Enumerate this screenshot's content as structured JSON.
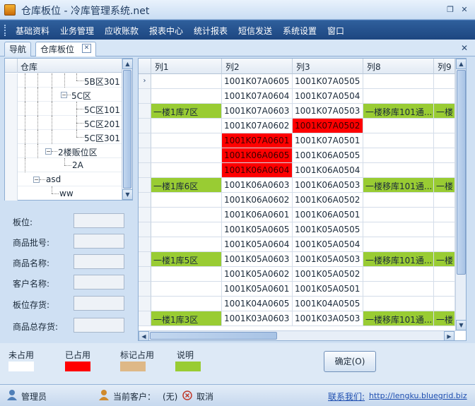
{
  "window": {
    "title": "仓库板位 - 冷库管理系统.net",
    "icon": "warehouse-app-icon",
    "restore_icon": "restore-icon",
    "close_icon": "close-icon"
  },
  "menu": [
    {
      "label": "基础资料"
    },
    {
      "label": "业务管理"
    },
    {
      "label": "应收账款"
    },
    {
      "label": "报表中心"
    },
    {
      "label": "统计报表"
    },
    {
      "label": "短信发送"
    },
    {
      "label": "系统设置"
    },
    {
      "label": "窗口"
    }
  ],
  "tabs": [
    {
      "label": "导航"
    },
    {
      "label": "仓库板位"
    }
  ],
  "tree": {
    "header": "仓库",
    "items": [
      {
        "label": "5B区301"
      },
      {
        "label": "5C区"
      },
      {
        "label": "5C区101"
      },
      {
        "label": "5C区201"
      },
      {
        "label": "5C区301"
      },
      {
        "label": "2楼贩位区"
      },
      {
        "label": "2A"
      },
      {
        "label": "asd"
      },
      {
        "label": "ww"
      }
    ]
  },
  "form": [
    {
      "label": "板位:"
    },
    {
      "label": "商品批号:"
    },
    {
      "label": "商品名称:"
    },
    {
      "label": "客户名称:"
    },
    {
      "label": "板位存货:"
    },
    {
      "label": "商品总存货:"
    }
  ],
  "grid": {
    "columns": [
      {
        "label": "列1"
      },
      {
        "label": "列2"
      },
      {
        "label": "列3"
      },
      {
        "label": "列8"
      },
      {
        "label": "列9"
      }
    ],
    "rows": [
      {
        "c1": "",
        "c2": "1001K07A0605",
        "c3": "1001K07A0505",
        "c8": "",
        "c9": "",
        "s2": "empty",
        "s3": "empty"
      },
      {
        "c1": "",
        "c2": "1001K07A0604",
        "c3": "1001K07A0504",
        "c8": "",
        "c9": "",
        "s2": "empty",
        "s3": "empty"
      },
      {
        "c1": "一楼1库7区",
        "c2": "1001K07A0603",
        "c3": "1001K07A0503",
        "c8": "一楼移库101通...",
        "c9": "一楼",
        "s2": "empty",
        "s3": "empty"
      },
      {
        "c1": "",
        "c2": "1001K07A0602",
        "c3": "1001K07A0502",
        "c8": "",
        "c9": "",
        "s2": "empty",
        "s3": "occupied"
      },
      {
        "c1": "",
        "c2": "1001K07A0601",
        "c3": "1001K07A0501",
        "c8": "",
        "c9": "",
        "s2": "occupied",
        "s3": "empty"
      },
      {
        "c1": "",
        "c2": "1001K06A0605",
        "c3": "1001K06A0505",
        "c8": "",
        "c9": "",
        "s2": "occupied",
        "s3": "empty"
      },
      {
        "c1": "",
        "c2": "1001K06A0604",
        "c3": "1001K06A0504",
        "c8": "",
        "c9": "",
        "s2": "occupied",
        "s3": "empty"
      },
      {
        "c1": "一楼1库6区",
        "c2": "1001K06A0603",
        "c3": "1001K06A0503",
        "c8": "一楼移库101通...",
        "c9": "一楼",
        "s2": "empty",
        "s3": "empty"
      },
      {
        "c1": "",
        "c2": "1001K06A0602",
        "c3": "1001K06A0502",
        "c8": "",
        "c9": "",
        "s2": "empty",
        "s3": "empty"
      },
      {
        "c1": "",
        "c2": "1001K06A0601",
        "c3": "1001K06A0501",
        "c8": "",
        "c9": "",
        "s2": "empty",
        "s3": "empty"
      },
      {
        "c1": "",
        "c2": "1001K05A0605",
        "c3": "1001K05A0505",
        "c8": "",
        "c9": "",
        "s2": "empty",
        "s3": "empty"
      },
      {
        "c1": "",
        "c2": "1001K05A0604",
        "c3": "1001K05A0504",
        "c8": "",
        "c9": "",
        "s2": "empty",
        "s3": "empty"
      },
      {
        "c1": "一楼1库5区",
        "c2": "1001K05A0603",
        "c3": "1001K05A0503",
        "c8": "一楼移库101通...",
        "c9": "一楼",
        "s2": "empty",
        "s3": "empty"
      },
      {
        "c1": "",
        "c2": "1001K05A0602",
        "c3": "1001K05A0502",
        "c8": "",
        "c9": "",
        "s2": "empty",
        "s3": "empty"
      },
      {
        "c1": "",
        "c2": "1001K05A0601",
        "c3": "1001K05A0501",
        "c8": "",
        "c9": "",
        "s2": "empty",
        "s3": "empty"
      },
      {
        "c1": "",
        "c2": "1001K04A0605",
        "c3": "1001K04A0505",
        "c8": "",
        "c9": "",
        "s2": "empty",
        "s3": "empty"
      },
      {
        "c1": "一楼1库3区",
        "c2": "1001K03A0603",
        "c3": "1001K03A0503",
        "c8": "一楼移库101通...",
        "c9": "一楼",
        "s2": "empty",
        "s3": "empty"
      }
    ]
  },
  "legend": {
    "items": [
      {
        "label": "未占用",
        "color": "#ffffff"
      },
      {
        "label": "已占用",
        "color": "#ff0000"
      },
      {
        "label": "标记占用",
        "color": "#deb887"
      },
      {
        "label": "说明",
        "color": "#99cc33"
      }
    ]
  },
  "ok_button": "确定(O)",
  "status": {
    "user": "管理员",
    "customer_label": "当前客户：",
    "customer_value": "(无)",
    "cancel": "取消",
    "contact_label": "联系我们:",
    "contact_url": "http://lengku.bluegrid.biz"
  },
  "colors": {
    "occupied": "#ff0000",
    "note": "#99cc33",
    "menubar": "#2a5a98"
  }
}
